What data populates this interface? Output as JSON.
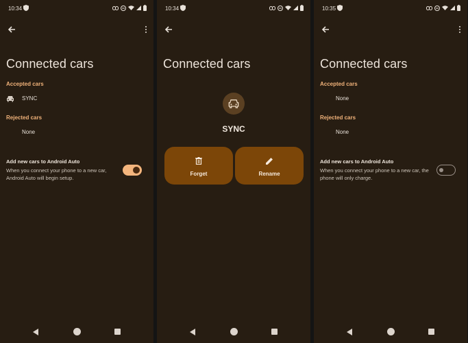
{
  "colors": {
    "accent": "#f0b27a",
    "background": "#271d12",
    "action_bg": "#7c4608"
  },
  "screens": [
    {
      "status": {
        "time": "10:34"
      },
      "title": "Connected cars",
      "accepted_label": "Accepted cars",
      "accepted_value": "SYNC",
      "rejected_label": "Rejected cars",
      "rejected_value": "None",
      "toggle_title": "Add new cars to Android Auto",
      "toggle_desc": "When you connect your phone to a new car, Android Auto will begin setup.",
      "toggle_on": true
    },
    {
      "status": {
        "time": "10:34"
      },
      "title": "Connected cars",
      "car_name": "SYNC",
      "forget_label": "Forget",
      "rename_label": "Rename"
    },
    {
      "status": {
        "time": "10:35"
      },
      "title": "Connected cars",
      "accepted_label": "Accepted cars",
      "accepted_value": "None",
      "rejected_label": "Rejected cars",
      "rejected_value": "None",
      "toggle_title": "Add new cars to Android Auto",
      "toggle_desc": "When you connect your phone to a new car, the phone will only charge.",
      "toggle_on": false
    }
  ]
}
